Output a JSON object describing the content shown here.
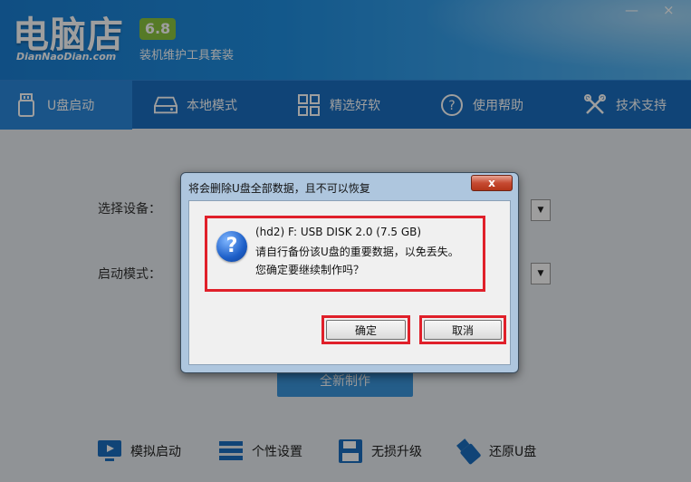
{
  "brand": {
    "logo_text": "电脑店",
    "logo_url_text": "DianNaoDian.com",
    "version": "6.8",
    "tagline": "装机维护工具套装"
  },
  "nav": [
    {
      "label": "U盘启动",
      "icon": "usb-drive-icon"
    },
    {
      "label": "本地模式",
      "icon": "hard-disk-icon"
    },
    {
      "label": "精选好软",
      "icon": "grid-apps-icon"
    },
    {
      "label": "使用帮助",
      "icon": "question-circle-icon"
    },
    {
      "label": "技术支持",
      "icon": "tools-icon"
    }
  ],
  "form": {
    "device_label": "选择设备：",
    "mode_label": "启动模式：",
    "start_button": "全新制作"
  },
  "tools": [
    {
      "label": "模拟启动",
      "icon": "monitor-play-icon"
    },
    {
      "label": "个性设置",
      "icon": "settings-sliders-icon"
    },
    {
      "label": "无损升级",
      "icon": "floppy-upgrade-icon"
    },
    {
      "label": "还原U盘",
      "icon": "usb-restore-icon"
    }
  ],
  "dialog": {
    "title": "将会删除U盘全部数据，且不可以恢复",
    "close_symbol": "x",
    "device_line": "(hd2) F: USB DISK 2.0 (7.5 GB)",
    "line2": "请自行备份该U盘的重要数据，以免丢失。",
    "line3": "您确定要继续制作吗？",
    "ok_label": "确定",
    "cancel_label": "取消"
  },
  "colors": {
    "header_blue": "#1f8ee0",
    "nav_blue": "#1a6fc0",
    "version_green": "#8bc53f",
    "highlight_red": "#e0202a"
  }
}
